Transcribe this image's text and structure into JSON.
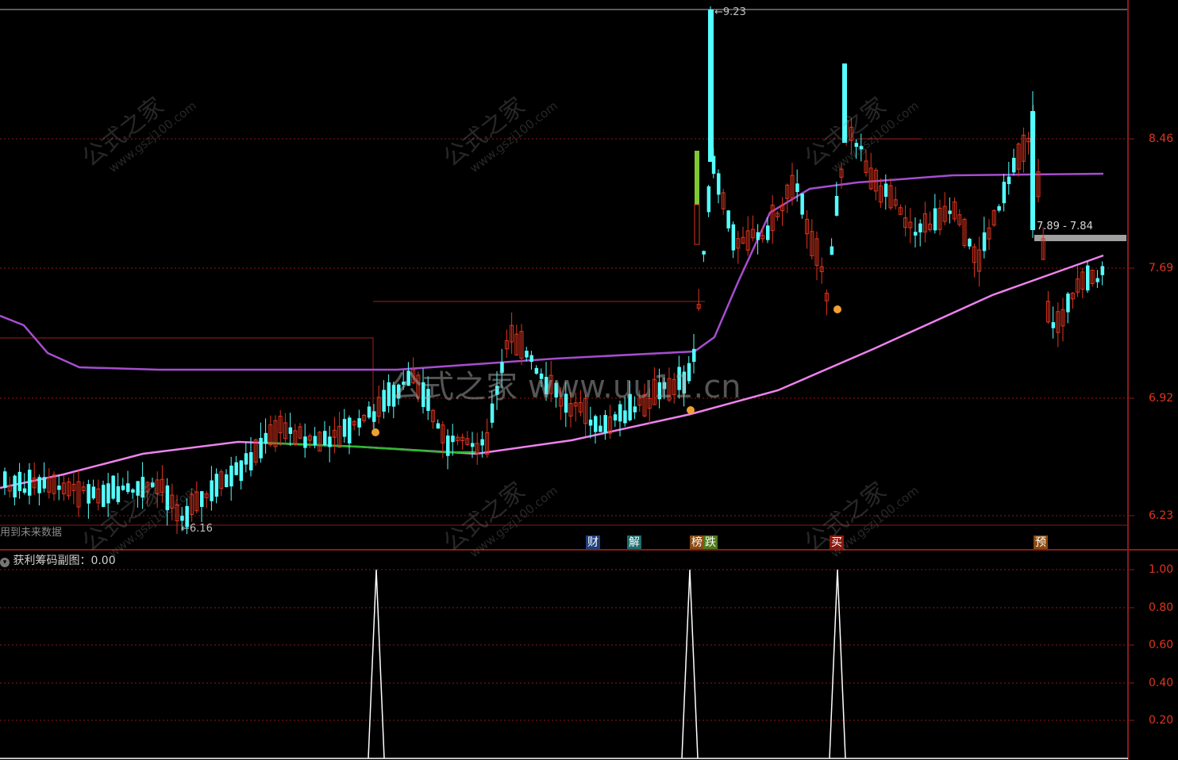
{
  "chart_data": [
    {
      "type": "candlestick",
      "panel": "main",
      "y_ticks": [
        "8.46",
        "7.69",
        "6.92",
        "6.23"
      ],
      "price_marks": {
        "high": "9.23",
        "low": "6.16",
        "range_label": "7.89 - 7.84"
      },
      "note": "用到未来数据",
      "signals": [
        {
          "text": "财",
          "color": "#3a7bd5"
        },
        {
          "text": "解",
          "color": "#29c0c0"
        },
        {
          "text": "榜",
          "color": "#e07a20"
        },
        {
          "text": "跌",
          "color": "#8bc34a"
        },
        {
          "text": "买",
          "color": "#e0341e"
        },
        {
          "text": "预",
          "color": "#e07a20"
        }
      ],
      "colors": {
        "up": "#e0341e",
        "down": "#54ffff",
        "ma_long": "#ee82ee",
        "ma_mid": "#a64dcf",
        "ma_green": "#2db82d",
        "grid": "#8b1a1a"
      }
    },
    {
      "type": "line",
      "panel": "sub",
      "title": "获利筹码副图",
      "value": "0.00",
      "y_ticks": [
        "1.00",
        "0.80",
        "0.60",
        "0.40",
        "0.20"
      ],
      "ylim": [
        0,
        1
      ],
      "series": [
        {
          "values": [
            0,
            1,
            0,
            0,
            1,
            0,
            1,
            0
          ]
        }
      ],
      "colors": {
        "line": "#ffffff"
      }
    }
  ],
  "watermark": {
    "text": "公式之家",
    "url": "www.gszj100.com",
    "center": "公式之家 www.uu11.cn"
  }
}
